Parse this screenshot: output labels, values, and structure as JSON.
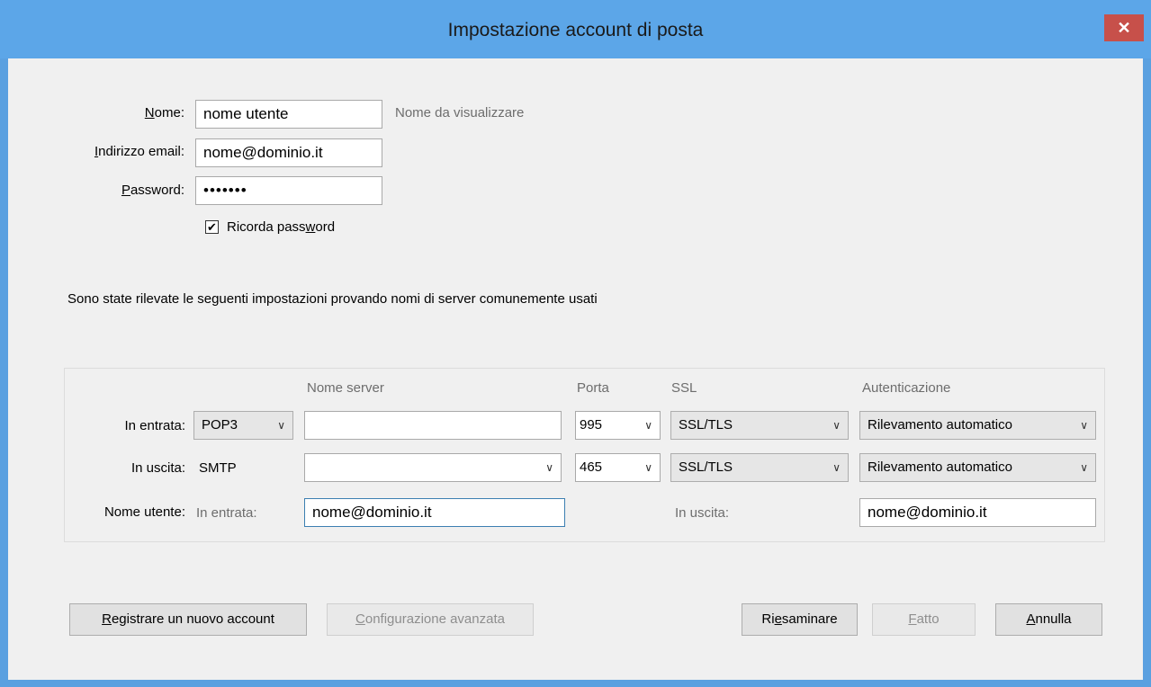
{
  "window": {
    "title": "Impostazione account di posta",
    "close_glyph": "✕"
  },
  "identity": {
    "name_label_u": "N",
    "name_label_rest": "ome:",
    "name_value": "nome utente",
    "name_hint": "Nome da visualizzare",
    "email_label_u": "I",
    "email_label_rest": "ndirizzo email:",
    "email_value": "nome@dominio.it",
    "password_label_u": "P",
    "password_label_rest": "assword:",
    "password_value": "•••••••",
    "remember_checked": "✔",
    "remember_label_pre": "Ricorda pass",
    "remember_label_u": "w",
    "remember_label_post": "ord"
  },
  "detected_message": "Sono state rilevate le seguenti impostazioni provando nomi di server comunemente usati",
  "server_table": {
    "headers": {
      "server_name": "Nome server",
      "port": "Porta",
      "ssl": "SSL",
      "auth": "Autenticazione"
    },
    "incoming": {
      "label": "In entrata:",
      "protocol": "POP3",
      "server": "",
      "port": "995",
      "ssl": "SSL/TLS",
      "auth": "Rilevamento automatico"
    },
    "outgoing": {
      "label": "In uscita:",
      "protocol": "SMTP",
      "server": "",
      "port": "465",
      "ssl": "SSL/TLS",
      "auth": "Rilevamento automatico"
    },
    "username": {
      "label": "Nome utente:",
      "incoming_label": "In entrata:",
      "incoming_value": "nome@dominio.it",
      "outgoing_label": "In uscita:",
      "outgoing_value": "nome@dominio.it"
    }
  },
  "buttons": {
    "register_u": "R",
    "register_rest": "egistrare un nuovo account",
    "advanced_u": "C",
    "advanced_rest": "onfigurazione avanzata",
    "retest_pre": "Ri",
    "retest_u": "e",
    "retest_post": "saminare",
    "done_u": "F",
    "done_rest": "atto",
    "cancel_u": "A",
    "cancel_rest": "nnulla"
  },
  "colors": {
    "titlebar": "#5ca6e8",
    "close": "#c7504a",
    "client_bg": "#f0f0f0"
  }
}
